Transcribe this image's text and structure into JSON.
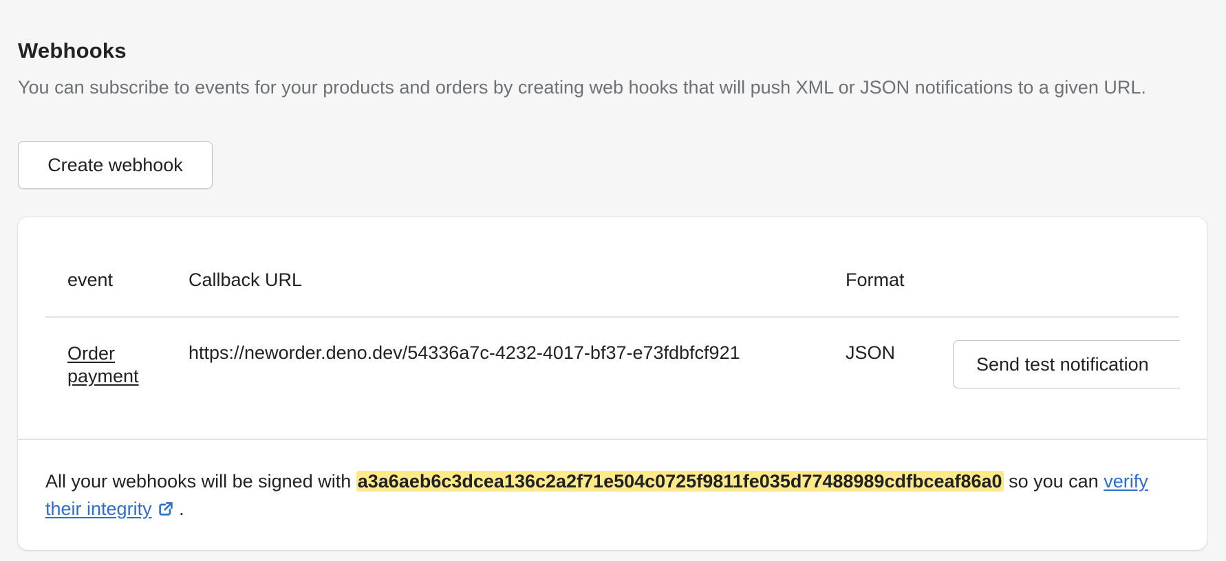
{
  "header": {
    "title": "Webhooks",
    "description": "You can subscribe to events for your products and orders by creating web hooks that will push XML or JSON notifications to a given URL.",
    "create_button_label": "Create webhook"
  },
  "table": {
    "columns": [
      "event",
      "Callback URL",
      "Format"
    ],
    "rows": [
      {
        "event": "Order payment",
        "callback_url": "https://neworder.deno.dev/54336a7c-4232-4017-bf37-e73fdbfcf921",
        "format": "JSON",
        "action_label": "Send test notification"
      }
    ]
  },
  "footer": {
    "prefix": "All your webhooks will be signed with",
    "secret": "a3a6aeb6c3dcea136c2a2f71e504c0725f9811fe035d77488989cdfbceaf86a0",
    "middle": "so you can",
    "link_label": "verify their integrity",
    "suffix": ".",
    "link_icon": "external-link-icon"
  },
  "colors": {
    "background": "#f6f6f7",
    "secret_highlight": "#ffea8a",
    "link": "#2c6ecb"
  }
}
